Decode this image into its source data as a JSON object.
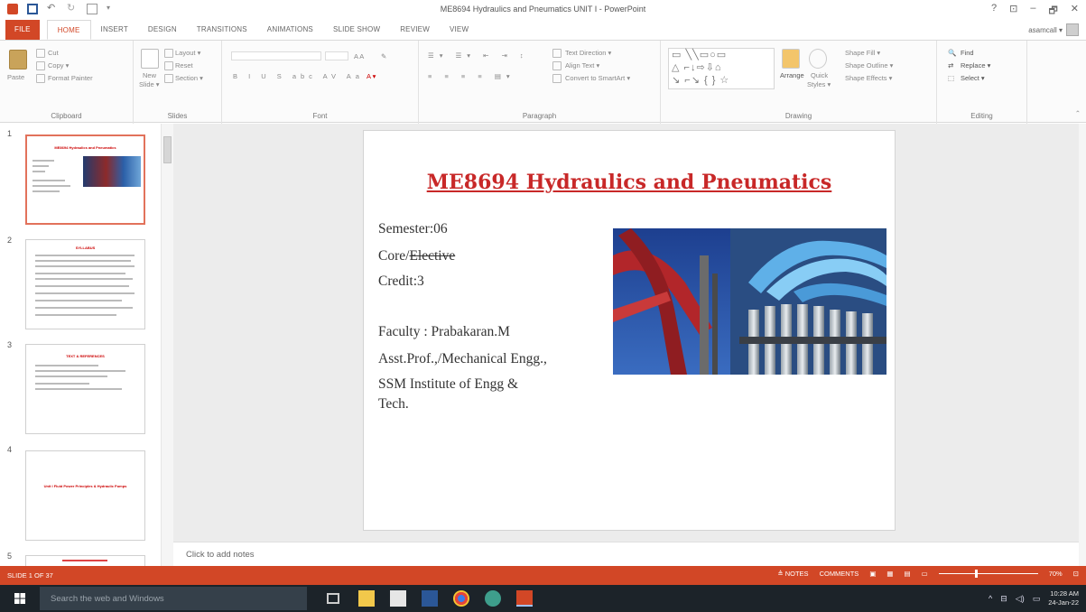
{
  "window": {
    "title": "ME8694 Hydraulics and Pneumatics UNIT I - PowerPoint",
    "account": "asamcall ▾",
    "controls": [
      "?",
      "⊡",
      "–",
      "🗗",
      "✕"
    ]
  },
  "tabs": [
    {
      "id": "file",
      "label": "FILE"
    },
    {
      "id": "home",
      "label": "HOME"
    },
    {
      "id": "insert",
      "label": "INSERT"
    },
    {
      "id": "design",
      "label": "DESIGN"
    },
    {
      "id": "transitions",
      "label": "TRANSITIONS"
    },
    {
      "id": "animations",
      "label": "ANIMATIONS"
    },
    {
      "id": "slideshow",
      "label": "SLIDE SHOW"
    },
    {
      "id": "review",
      "label": "REVIEW"
    },
    {
      "id": "view",
      "label": "VIEW"
    }
  ],
  "ribbon": {
    "clipboard": {
      "group": "Clipboard",
      "paste": "Paste",
      "cut": "Cut",
      "copy": "Copy ▾",
      "format_painter": "Format Painter"
    },
    "slides": {
      "group": "Slides",
      "new_slide": "New",
      "new_slide2": "Slide ▾",
      "layout": "Layout ▾",
      "reset": "Reset",
      "section": "Section ▾"
    },
    "font": {
      "group": "Font"
    },
    "paragraph": {
      "group": "Paragraph",
      "text_direction": "Text Direction ▾",
      "align_text": "Align Text ▾",
      "convert_smartart": "Convert to SmartArt ▾"
    },
    "drawing": {
      "group": "Drawing",
      "arrange": "Arrange",
      "quick_styles": "Quick",
      "quick_styles2": "Styles ▾",
      "shape_fill": "Shape Fill ▾",
      "shape_outline": "Shape Outline ▾",
      "shape_effects": "Shape Effects ▾"
    },
    "editing": {
      "group": "Editing",
      "find": "Find",
      "replace": "Replace ▾",
      "select": "Select ▾"
    }
  },
  "thumbnails": [
    {
      "num": "1",
      "title": "ME8694 Hydraulics and Pneumatics"
    },
    {
      "num": "2",
      "title": "SYLLABUS"
    },
    {
      "num": "3",
      "title": "TEXT & REFERENCES"
    },
    {
      "num": "4",
      "title": "Unit I Fluid Power Principles & Hydraulic Pumps"
    },
    {
      "num": "5",
      "title": ""
    }
  ],
  "slide": {
    "title": "ME8694 Hydraulics and Pneumatics",
    "semester": "Semester:06",
    "core": "Core/",
    "elective": "Elective",
    "credit": "Credit:3",
    "faculty": "Faculty : Prabakaran.M",
    "designation": "Asst.Prof.,/Mechanical Engg.,",
    "institute_1": "SSM Institute of Engg &",
    "institute_2": "Tech."
  },
  "notes": {
    "placeholder": "Click to add notes"
  },
  "status": {
    "slide_info": "SLIDE 1 OF 37",
    "notes": "≜ NOTES",
    "comments": "COMMENTS",
    "zoom": "70%"
  },
  "taskbar": {
    "search_placeholder": "Search the web and Windows",
    "time": "10:28 AM",
    "date": "24-Jan-22"
  },
  "colors": {
    "accent": "#d24726",
    "slide_title": "#c82828",
    "taskbar": "#1c2329"
  }
}
